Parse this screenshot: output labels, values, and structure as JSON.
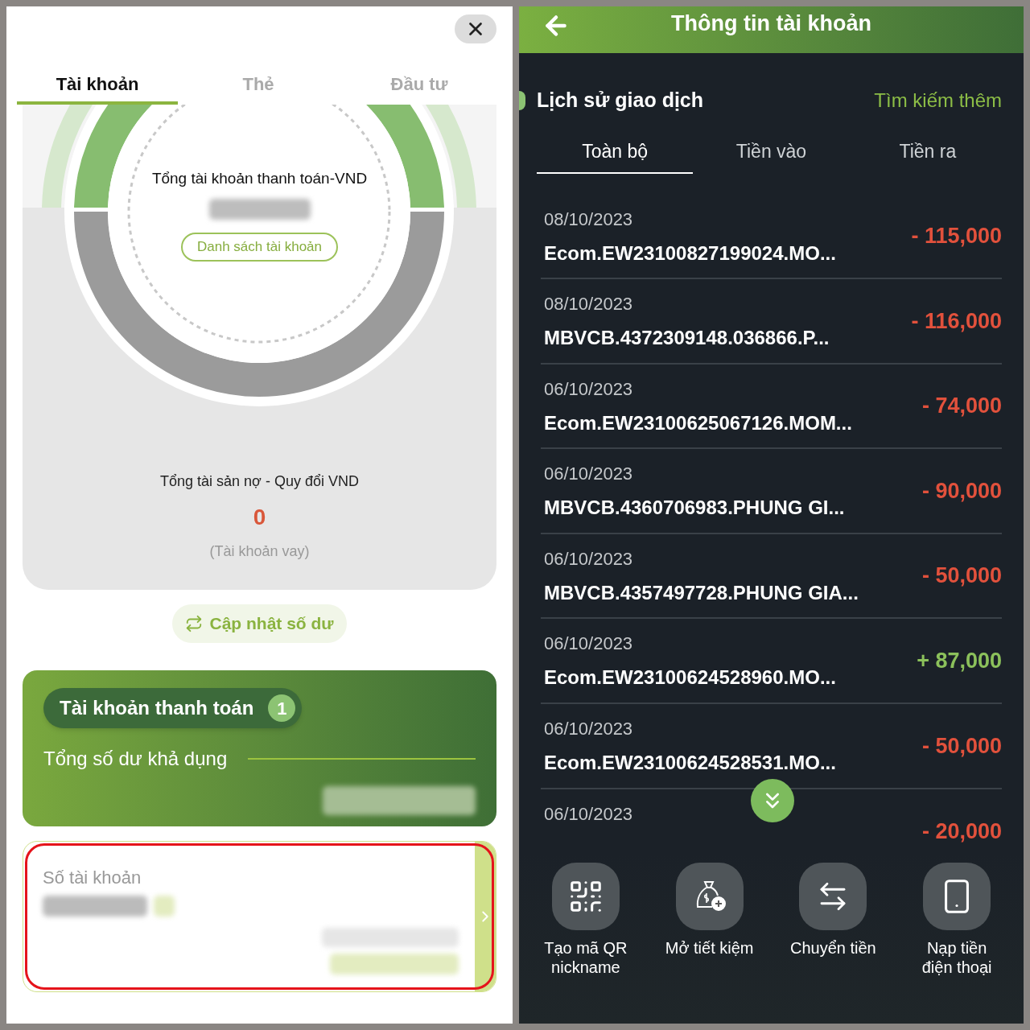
{
  "left_screen": {
    "tabs": [
      {
        "label": "Tài khoản",
        "selected": true
      },
      {
        "label": "Thẻ",
        "selected": false
      },
      {
        "label": "Đầu tư",
        "selected": false
      }
    ],
    "summary": {
      "title": "Tổng tài khoản thanh toán-VND",
      "button": "Danh sách tài khoản"
    },
    "debt": {
      "label": "Tổng tài sản nợ - Quy đổi VND",
      "value": "0",
      "note": "(Tài khoản vay)"
    },
    "refresh_button": "Cập nhật số dư",
    "account_group": {
      "title": "Tài khoản thanh toán",
      "count": "1",
      "balance_label": "Tổng số dư khả dụng"
    },
    "account_card": {
      "label": "Số tài khoản",
      "highlighted": true
    }
  },
  "right_screen": {
    "header": {
      "title": "Thông tin tài khoản"
    },
    "section": {
      "title": "Lịch sử giao dịch",
      "link": "Tìm kiếm thêm"
    },
    "tabs": [
      {
        "label": "Toàn bộ",
        "selected": true
      },
      {
        "label": "Tiền vào",
        "selected": false
      },
      {
        "label": "Tiền ra",
        "selected": false
      }
    ],
    "transactions": [
      {
        "date": "08/10/2023",
        "description": "Ecom.EW23100827199024.MO...",
        "amount": "- 115,000",
        "kind": "debit"
      },
      {
        "date": "08/10/2023",
        "description": "MBVCB.4372309148.036866.P...",
        "amount": "- 116,000",
        "kind": "debit"
      },
      {
        "date": "06/10/2023",
        "description": "Ecom.EW23100625067126.MOM...",
        "amount": "- 74,000",
        "kind": "debit"
      },
      {
        "date": "06/10/2023",
        "description": "MBVCB.4360706983.PHUNG GI...",
        "amount": "- 90,000",
        "kind": "debit"
      },
      {
        "date": "06/10/2023",
        "description": "MBVCB.4357497728.PHUNG GIA...",
        "amount": "- 50,000",
        "kind": "debit"
      },
      {
        "date": "06/10/2023",
        "description": "Ecom.EW23100624528960.MO...",
        "amount": "+ 87,000",
        "kind": "credit"
      },
      {
        "date": "06/10/2023",
        "description": "Ecom.EW23100624528531.MO...",
        "amount": "- 50,000",
        "kind": "debit"
      },
      {
        "date": "06/10/2023",
        "amount": "- 20,000",
        "kind": "debit"
      }
    ],
    "actions": [
      {
        "label": "Tạo mã QR\nnickname",
        "kind": "qr"
      },
      {
        "label": "Mở tiết kiệm",
        "kind": "savings"
      },
      {
        "label": "Chuyển tiền",
        "kind": "transfer"
      },
      {
        "label": "Nạp tiền\nđiện thoại",
        "kind": "phone"
      }
    ]
  }
}
